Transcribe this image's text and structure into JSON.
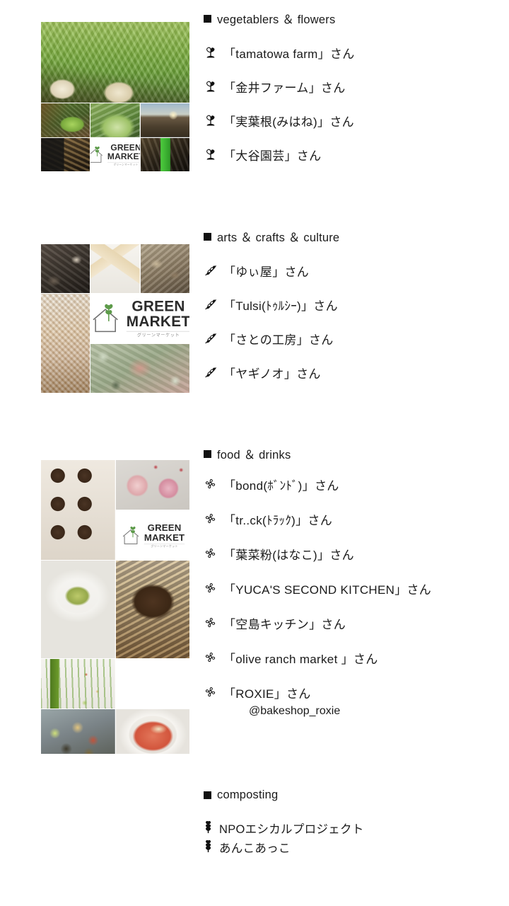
{
  "page": {
    "background": "#ffffff",
    "text_color": "#1a1a1a",
    "bullet_color": "#111111"
  },
  "sections": [
    {
      "id": "vegetables-flowers",
      "heading": "vegetablers ＆ flowers",
      "icon_name": "seedling-icon",
      "entries": [
        {
          "label": "「tamatowa farm」さん"
        },
        {
          "label": "「金井ファーム」さん"
        },
        {
          "label": "「実葉根(みはね)」さん"
        },
        {
          "label": "「大谷園芸」さん"
        }
      ],
      "collage": {
        "name": "vegetables-photo-collage",
        "tiles": [
          {
            "name": "daikon-turnip-field-photo"
          },
          {
            "name": "lettuce-garden-bed-photo"
          },
          {
            "name": "cabbage-leaves-photo"
          },
          {
            "name": "tilled-field-horizon-photo"
          },
          {
            "name": "market-stall-chalkboard-photo"
          },
          {
            "name": "green-market-logo-tile"
          },
          {
            "name": "green-painted-farm-sign-photo"
          }
        ]
      }
    },
    {
      "id": "arts-crafts-culture",
      "heading": "arts ＆ crafts ＆ culture",
      "icon_name": "herb-sprig-icon",
      "entries": [
        {
          "label": "「ゆぃ屋」さん"
        },
        {
          "label": "「Tulsi(ﾄｩﾙｼｰ)」さん"
        },
        {
          "label": "「さとの工房」さん"
        },
        {
          "label": "「ヤギノオ」さん"
        }
      ],
      "collage": {
        "name": "crafts-photo-collage",
        "tiles": [
          {
            "name": "dark-tray-craft-still-life-photo"
          },
          {
            "name": "handmade-soap-bars-photo"
          },
          {
            "name": "dried-botanicals-photo"
          },
          {
            "name": "woven-straw-basket-photo"
          },
          {
            "name": "green-market-logo-tile"
          },
          {
            "name": "succulent-wreath-photo"
          }
        ]
      }
    },
    {
      "id": "food-drinks",
      "heading": "food ＆ drinks",
      "icon_name": "blossom-icon",
      "entries": [
        {
          "label": "「bond(ﾎﾞﾝﾄﾞ)」さん"
        },
        {
          "label": "「tr..ck(ﾄﾗｯｸ)」さん"
        },
        {
          "label": "「葉菜粉(はなこ)」さん"
        },
        {
          "label": "「YUCA'S SECOND KITCHEN」さん"
        },
        {
          "label": "「空島キッチン」さん"
        },
        {
          "label": "「olive ranch market 」さん"
        },
        {
          "label": "「ROXIE」さん",
          "sub": "@bakeshop_roxie"
        }
      ],
      "collage": {
        "name": "food-photo-collage",
        "tiles": [
          {
            "name": "chocolate-muffins-tray-photo"
          },
          {
            "name": "pink-flower-shaped-cakes-photo"
          },
          {
            "name": "green-market-logo-tile-1"
          },
          {
            "name": "avocado-bowl-white-plate-photo"
          },
          {
            "name": "rustic-sourdough-bread-photo"
          },
          {
            "name": "olive-oil-bottle-flatlay-photo"
          },
          {
            "name": "rice-soup-bowl-photo"
          },
          {
            "name": "green-market-logo-tile-2"
          },
          {
            "name": "deli-salad-bowl-photo"
          },
          {
            "name": "tomato-cream-soup-photo"
          }
        ]
      }
    },
    {
      "id": "composting",
      "heading": "composting",
      "icon_name": "compost-sprout-icon",
      "entries": [
        {
          "label": "NPOエシカルプロジェクト"
        },
        {
          "label": "あんこあっこ"
        }
      ]
    }
  ],
  "logo": {
    "name": "green-market-logo",
    "word_top": "GREEN",
    "word_bottom": "MARKET",
    "kana": "グリーンマーケット",
    "leaf_color": "#5d9b4a",
    "outline_color": "#6f6f6f",
    "text_color": "#2b2b2b"
  }
}
